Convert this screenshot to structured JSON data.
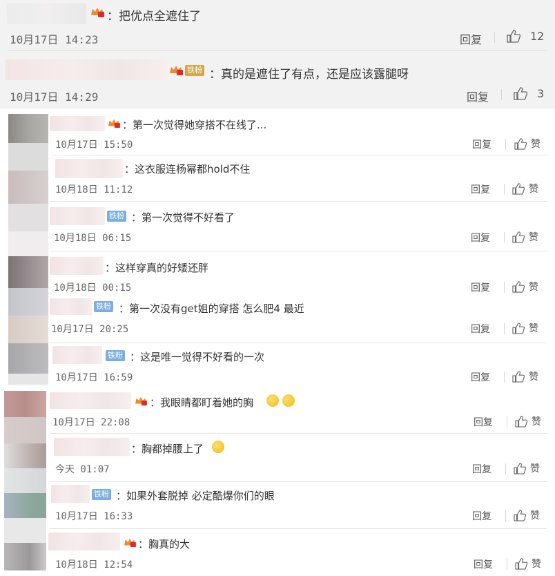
{
  "top_comments": [
    {
      "text": "：把优点全遮住了",
      "time": "10月17日 14:23",
      "reply": "回复",
      "likes": "12"
    },
    {
      "text": "：真的是遮住了有点，还是应该露腿呀",
      "badge": "铁粉",
      "time": "10月17日 14:29",
      "reply": "回复",
      "likes": "3"
    }
  ],
  "replies": [
    {
      "text": "：第一次觉得她穿搭不在线了...",
      "time": "10月17日 15:50",
      "reply": "回复",
      "like": "赞"
    },
    {
      "text": "：这衣服连杨幂都hold不住",
      "time": "10月18日 11:12",
      "reply": "回复",
      "like": "赞"
    },
    {
      "text": "：第一次觉得不好看了",
      "badge": "铁粉",
      "time": "10月18日 06:15",
      "reply": "回复",
      "like": "赞"
    },
    {
      "text": "：这样穿真的好矮还胖",
      "time": "10月18日 00:15",
      "reply": "回复",
      "like": "赞"
    },
    {
      "text": "：第一次没有get姐的穿搭 怎么肥4   最近",
      "badge": "铁粉",
      "time": "10月17日 20:25",
      "reply": "回复",
      "like": "赞"
    },
    {
      "text": "：这是唯一觉得不好看的一次",
      "badge": "铁粉",
      "time": "10月17日 16:59",
      "reply": "回复",
      "like": "赞"
    },
    {
      "text": "：我眼睛都盯着她的胸",
      "time": "10月17日 22:08",
      "reply": "回复",
      "like": "赞"
    },
    {
      "text": "：胸都掉腰上了",
      "time": "今天 01:07",
      "reply": "回复",
      "like": "赞"
    },
    {
      "text": "：如果外套脱掉 必定酷爆你们的眼",
      "badge": "铁粉",
      "time": "10月17日 16:33",
      "reply": "回复",
      "like": "赞"
    },
    {
      "text": "：胸真的大",
      "time": "10月18日 12:54",
      "reply": "回复",
      "like": "赞"
    }
  ],
  "icons": {
    "vip": "vip-crown-icon",
    "like": "thumbs-up-icon",
    "emoji": "laughing-tears-emoji-icon"
  },
  "colors": {
    "top_bg": "#f2f2f2",
    "text": "#333333",
    "time": "#666666",
    "fan_badge": "#7aaee3"
  }
}
